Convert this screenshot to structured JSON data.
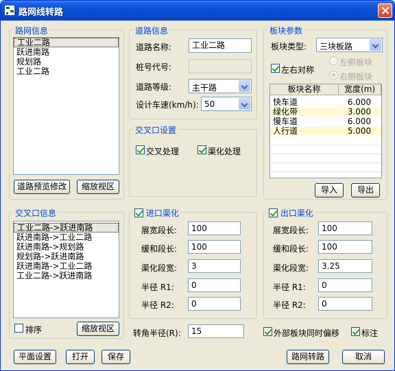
{
  "window": {
    "title": "路网线转路"
  },
  "road_network": {
    "title": "路网信息",
    "items": [
      "工业二路",
      "跃进南路",
      "规划路",
      "工业二路"
    ],
    "preview_btn": "道路预览修改",
    "zoom_btn": "缩放视区"
  },
  "road_info": {
    "title": "道路信息",
    "name_label": "道路名称:",
    "name_value": "工业二路",
    "stake_label": "桩号代号:",
    "stake_value": "",
    "grade_label": "道路等级:",
    "grade_value": "主干路",
    "speed_label": "设计车速(km/h):",
    "speed_value": "50"
  },
  "intersection_settings": {
    "title": "交叉口设置",
    "cross_label": "交叉处理",
    "channel_label": "渠化处理"
  },
  "block_params": {
    "title": "板块参数",
    "type_label": "板块类型:",
    "type_value": "三块板路",
    "symmetric_label": "左右对称",
    "left_label": "左侧板块",
    "right_label": "右侧板块",
    "col_name": "板块名称",
    "col_width": "宽度(m)",
    "rows": [
      {
        "name": "快车道",
        "width": "6.000"
      },
      {
        "name": "绿化带",
        "width": "3.000"
      },
      {
        "name": "慢车道",
        "width": "6.000"
      },
      {
        "name": "人行道",
        "width": "5.000"
      }
    ],
    "import_btn": "导入",
    "export_btn": "导出"
  },
  "intersection_info": {
    "title": "交叉口信息",
    "items": [
      "工业二路->跃进南路",
      "跃进南路->工业二路",
      "跃进南路->规划路",
      "规划路->跃进南路",
      "跃进南路->工业二路",
      "工业二路->跃进南路"
    ],
    "sort_label": "排序",
    "zoom_btn": "缩放视区"
  },
  "entry_channel": {
    "title": "进口渠化",
    "widen_label": "展宽段长:",
    "widen_value": "100",
    "taper_label": "缓和段长:",
    "taper_value": "100",
    "width_label": "渠化段宽:",
    "width_value": "3",
    "r1_label": "半径 R1:",
    "r1_value": "0",
    "r2_label": "半径 R2:",
    "r2_value": "0"
  },
  "exit_channel": {
    "title": "出口渠化",
    "widen_label": "展宽段长:",
    "widen_value": "100",
    "taper_label": "缓和段长:",
    "taper_value": "100",
    "width_label": "渠化段宽:",
    "width_value": "3.25",
    "r1_label": "半径 R1:",
    "r1_value": "0",
    "r2_label": "半径 R2:",
    "r2_value": "0"
  },
  "bottom": {
    "turn_radius_label": "转角半径(R):",
    "turn_radius_value": "15",
    "offset_label": "外部板块同时偏移",
    "annotate_label": "标注",
    "plane_btn": "平面设置",
    "open_btn": "打开",
    "save_btn": "保存",
    "convert_btn": "路网转路",
    "cancel_btn": "取消"
  }
}
